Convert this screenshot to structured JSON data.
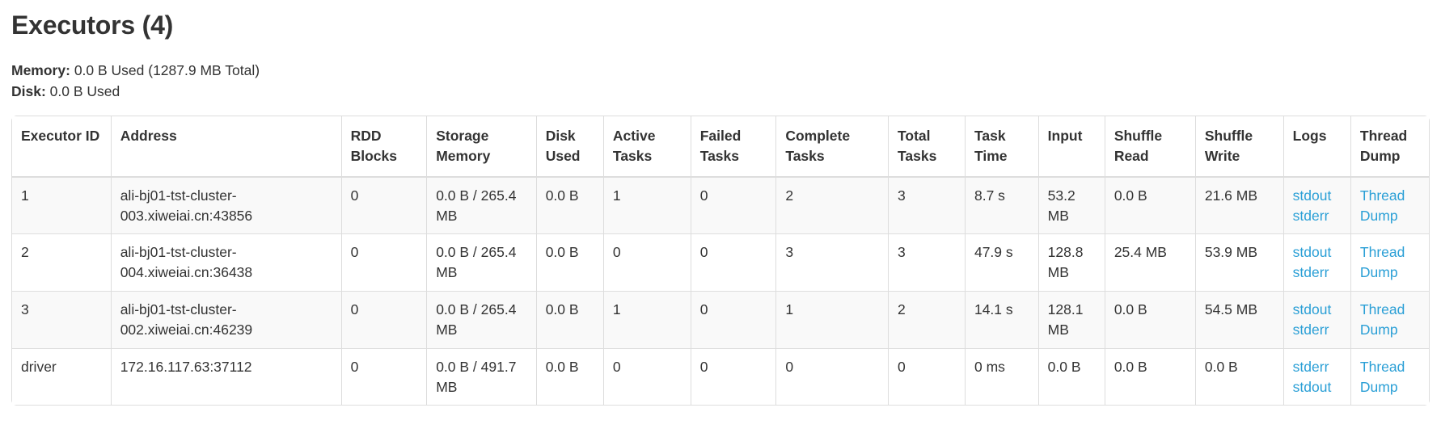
{
  "header": {
    "title": "Executors (4)",
    "memory_label": "Memory:",
    "memory_value": "0.0 B Used (1287.9 MB Total)",
    "disk_label": "Disk:",
    "disk_value": "0.0 B Used"
  },
  "table": {
    "columns": [
      "Executor ID",
      "Address",
      "RDD Blocks",
      "Storage Memory",
      "Disk Used",
      "Active Tasks",
      "Failed Tasks",
      "Complete Tasks",
      "Total Tasks",
      "Task Time",
      "Input",
      "Shuffle Read",
      "Shuffle Write",
      "Logs",
      "Thread Dump"
    ],
    "rows": [
      {
        "executor_id": "1",
        "address": "ali-bj01-tst-cluster-003.xiweiai.cn:43856",
        "rdd_blocks": "0",
        "storage_memory": "0.0 B / 265.4 MB",
        "disk_used": "0.0 B",
        "active_tasks": "1",
        "failed_tasks": "0",
        "complete_tasks": "2",
        "total_tasks": "3",
        "task_time": "8.7 s",
        "input": "53.2 MB",
        "shuffle_read": "0.0 B",
        "shuffle_write": "21.6 MB",
        "logs": [
          "stdout",
          "stderr"
        ],
        "thread_dump": "Thread Dump"
      },
      {
        "executor_id": "2",
        "address": "ali-bj01-tst-cluster-004.xiweiai.cn:36438",
        "rdd_blocks": "0",
        "storage_memory": "0.0 B / 265.4 MB",
        "disk_used": "0.0 B",
        "active_tasks": "0",
        "failed_tasks": "0",
        "complete_tasks": "3",
        "total_tasks": "3",
        "task_time": "47.9 s",
        "input": "128.8 MB",
        "shuffle_read": "25.4 MB",
        "shuffle_write": "53.9 MB",
        "logs": [
          "stdout",
          "stderr"
        ],
        "thread_dump": "Thread Dump"
      },
      {
        "executor_id": "3",
        "address": "ali-bj01-tst-cluster-002.xiweiai.cn:46239",
        "rdd_blocks": "0",
        "storage_memory": "0.0 B / 265.4 MB",
        "disk_used": "0.0 B",
        "active_tasks": "1",
        "failed_tasks": "0",
        "complete_tasks": "1",
        "total_tasks": "2",
        "task_time": "14.1 s",
        "input": "128.1 MB",
        "shuffle_read": "0.0 B",
        "shuffle_write": "54.5 MB",
        "logs": [
          "stdout",
          "stderr"
        ],
        "thread_dump": "Thread Dump"
      },
      {
        "executor_id": "driver",
        "address": "172.16.117.63:37112",
        "rdd_blocks": "0",
        "storage_memory": "0.0 B / 491.7 MB",
        "disk_used": "0.0 B",
        "active_tasks": "0",
        "failed_tasks": "0",
        "complete_tasks": "0",
        "total_tasks": "0",
        "task_time": "0 ms",
        "input": "0.0 B",
        "shuffle_read": "0.0 B",
        "shuffle_write": "0.0 B",
        "logs": [
          "stderr",
          "stdout"
        ],
        "thread_dump": "Thread Dump"
      }
    ]
  },
  "colors": {
    "link": "#2a9fd6",
    "text": "#333333",
    "border": "#dddddd",
    "row_odd_bg": "#f9f9f9"
  }
}
